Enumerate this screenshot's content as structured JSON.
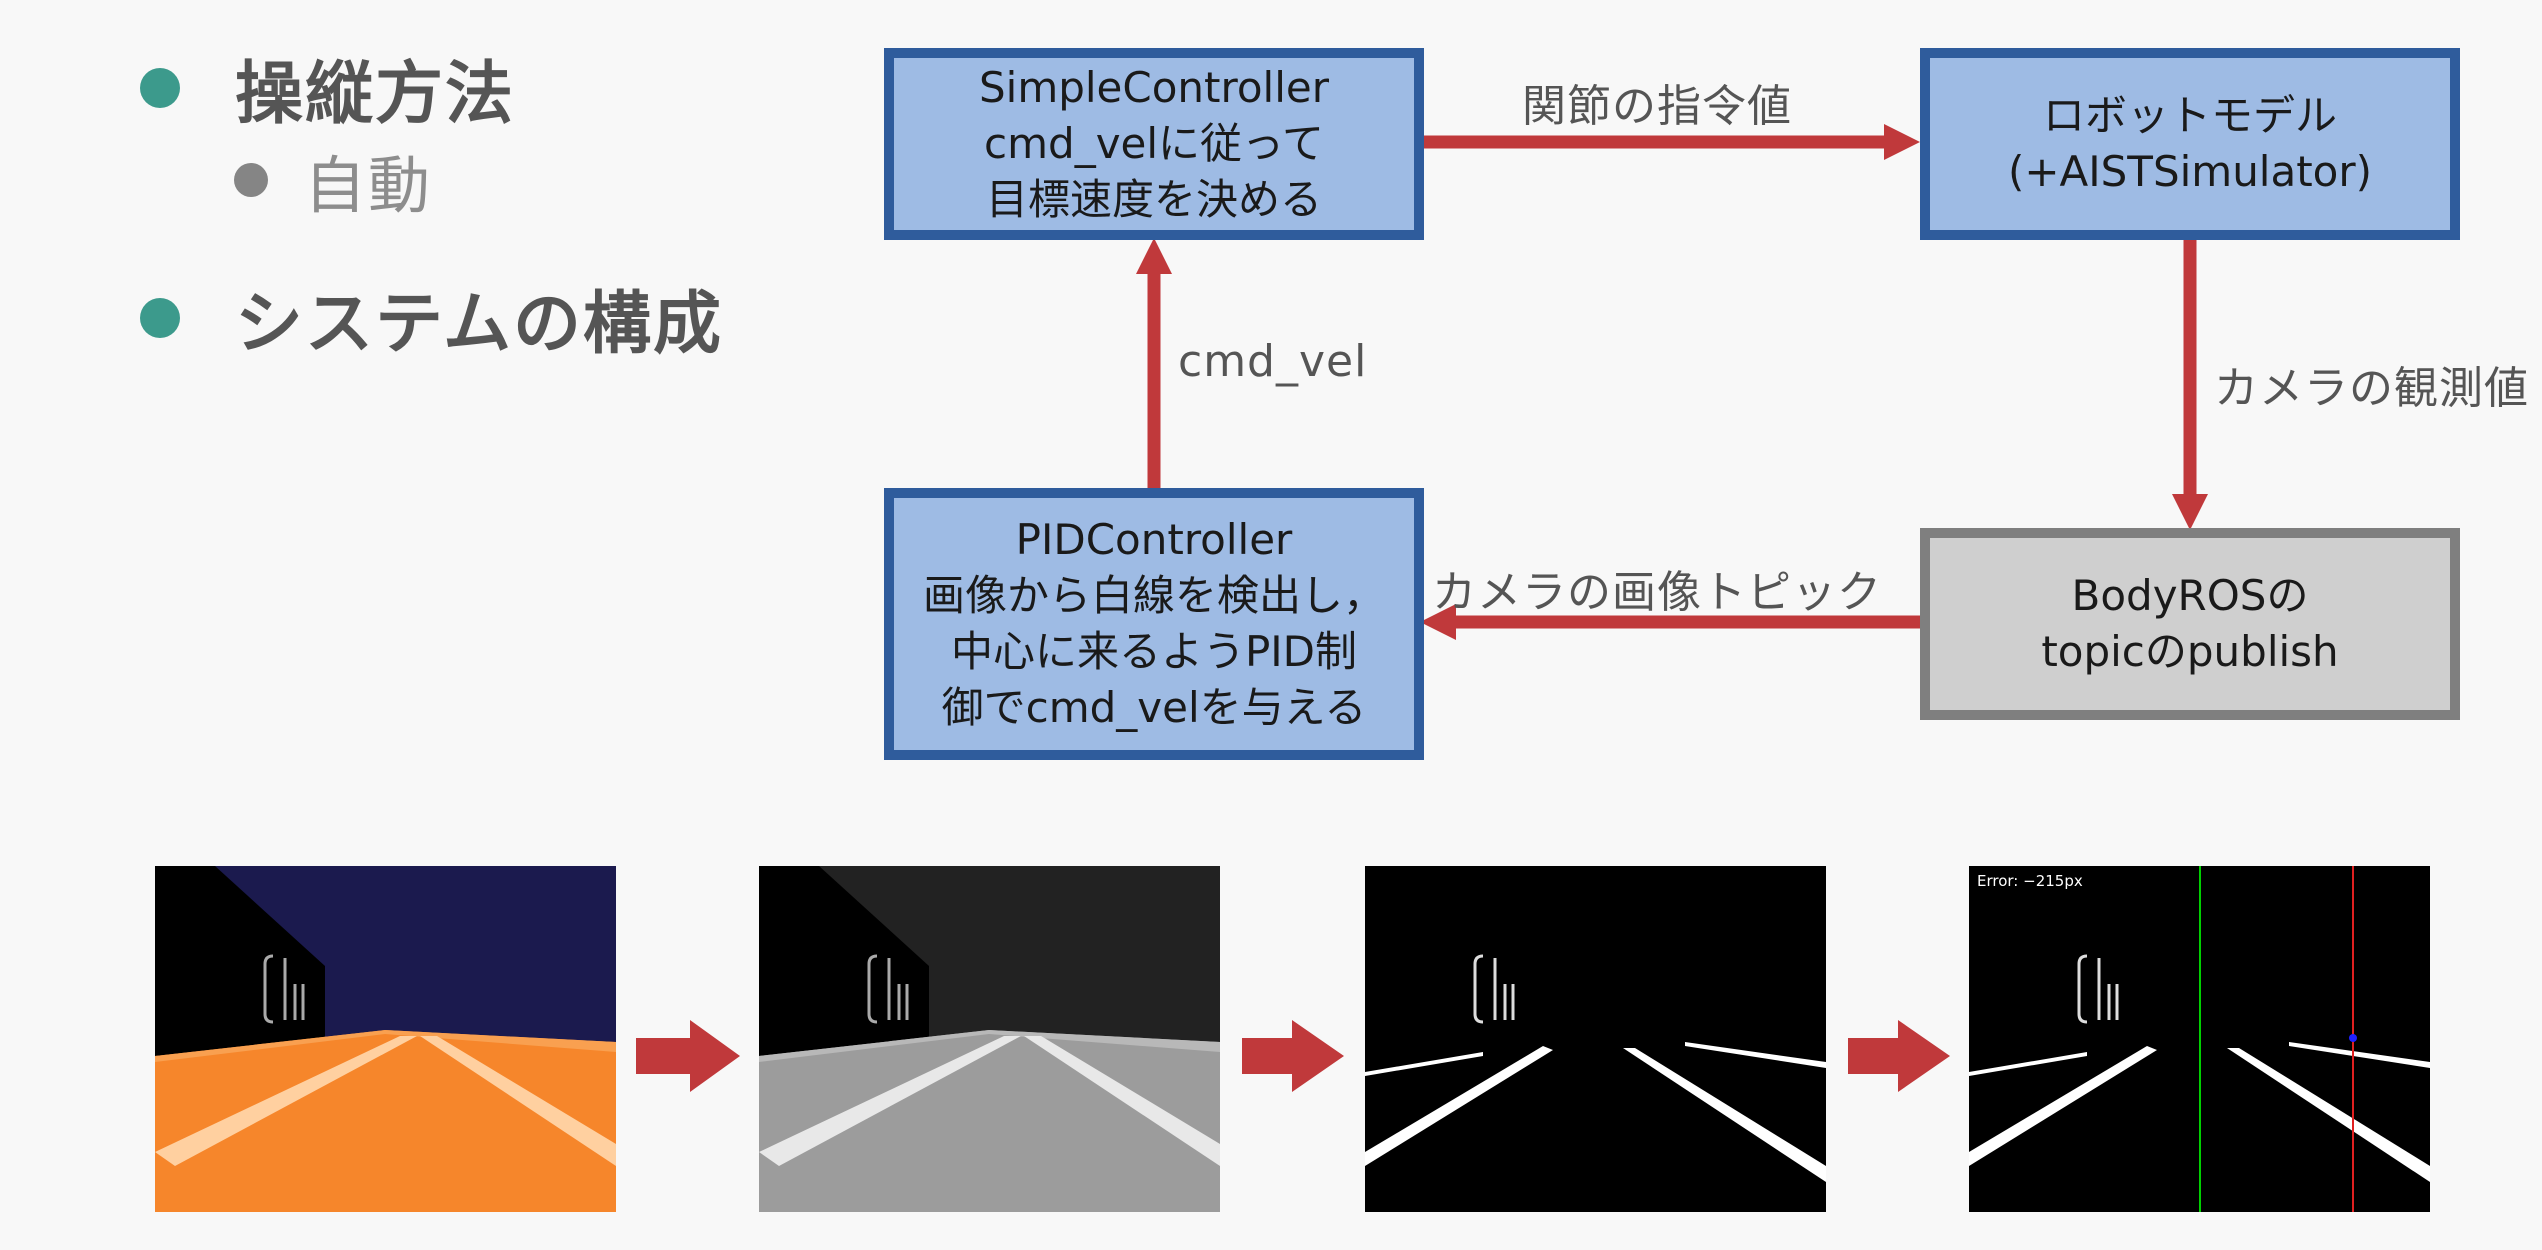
{
  "bullets": {
    "operation": "操縦方法",
    "auto": "自動",
    "system": "システムの構成"
  },
  "nodes": {
    "simple": {
      "line1": "SimpleController",
      "line2": "cmd_velに従って",
      "line3": "目標速度を決める"
    },
    "robot": {
      "line1": "ロボットモデル",
      "line2": "(+AISTSimulator)"
    },
    "pid": {
      "line1": "PIDController",
      "line2": "画像から白線を検出し，",
      "line3": "中心に来るようPID制",
      "line4": "御でcmd_velを与える"
    },
    "bodyros": {
      "line1": "BodyROSの",
      "line2": "topicのpublish"
    }
  },
  "edges": {
    "joint_command": "関節の指令値",
    "camera_observation": "カメラの観測値",
    "camera_image_topic": "カメラの画像トピック",
    "cmd_vel": "cmd_vel"
  },
  "screenshots": {
    "error_text": "Error: −215px"
  },
  "colors": {
    "arrow": "#c0393b",
    "node_fill": "#9ebbe4",
    "node_border": "#2f5c9c",
    "gray_fill": "#cfcfcf",
    "gray_border": "#7f7f7f",
    "bullet": "#3c9a8c"
  }
}
